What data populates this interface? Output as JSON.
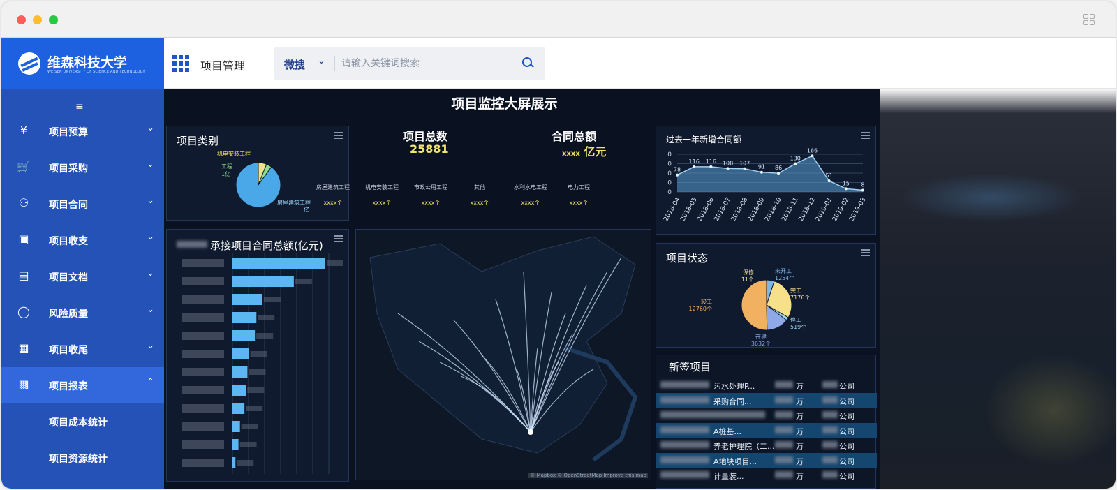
{
  "brand": {
    "name": "维森科技大学",
    "subtitle": "WEISEN UNIVERSITY OF SCIENCE AND TECHNOLOGY"
  },
  "sidebar": {
    "items": [
      {
        "label": "项目预算",
        "icon": "wallet-yen-icon"
      },
      {
        "label": "项目采购",
        "icon": "cart-icon"
      },
      {
        "label": "项目合同",
        "icon": "stamp-icon"
      },
      {
        "label": "项目收支",
        "icon": "purse-icon"
      },
      {
        "label": "项目文档",
        "icon": "inbox-icon"
      },
      {
        "label": "风险质量",
        "icon": "shield-check-icon"
      },
      {
        "label": "项目收尾",
        "icon": "archive-icon"
      },
      {
        "label": "项目报表",
        "icon": "chart-icon",
        "expanded": true
      }
    ],
    "subitems": [
      "项目成本统计",
      "项目资源统计"
    ]
  },
  "header": {
    "module": "项目管理",
    "search": {
      "scope": "微搜",
      "placeholder": "请输入关键词搜索"
    }
  },
  "dashboard": {
    "title": "项目监控大屏展示",
    "kpis": {
      "projects": {
        "label": "项目总数",
        "value": "25881"
      },
      "contracts": {
        "label": "合同总额",
        "value_prefix": "xxxx",
        "value_unit": "亿元"
      }
    },
    "categories": [
      {
        "name": "房屋建筑工程",
        "value": "xxxx个"
      },
      {
        "name": "机电安装工程",
        "value": "xxxx个"
      },
      {
        "name": "市政公用工程",
        "value": "xxxx个"
      },
      {
        "name": "其他",
        "value": "xxxx个"
      },
      {
        "name": "水利水电工程",
        "value": "xxxx个"
      },
      {
        "name": "电力工程",
        "value": "xxxx个"
      }
    ],
    "panels": {
      "category": "项目类别",
      "contract_total": "承接项目合同总额(亿元)",
      "monthly": "过去一年新增合同额",
      "status": "项目状态",
      "new_projects": "新签项目"
    },
    "map_attribution": "© Mapbox © OpenStreetMap Improve this map",
    "new_projects": [
      {
        "name": "污水处理P...",
        "amount": "万",
        "company": "公司"
      },
      {
        "name": "采购合同...",
        "amount": "万",
        "company": "公司"
      },
      {
        "name": "",
        "amount": "万",
        "company": "公司"
      },
      {
        "name": "A桩基...",
        "amount": "万",
        "company": "公司"
      },
      {
        "name": "养老护理院（二...",
        "amount": "万",
        "company": "公司"
      },
      {
        "name": "A地块项目...",
        "amount": "万",
        "company": "公司"
      },
      {
        "name": "计量装...",
        "amount": "万",
        "company": "公司"
      }
    ]
  },
  "chart_data": [
    {
      "type": "pie",
      "title": "项目类别",
      "labels": [
        "机电安装工程",
        "工程",
        "房屋建筑工程"
      ],
      "label_values": [
        "",
        "1亿",
        "亿"
      ],
      "values": [
        6,
        4,
        90
      ],
      "colors": [
        "#f2e38a",
        "#8fe08a",
        "#4aa8e8"
      ]
    },
    {
      "type": "bar",
      "title": "承接项目合同总额(亿元)",
      "orientation": "horizontal",
      "values": [
        62,
        41,
        20,
        16,
        15,
        11,
        10,
        9,
        8,
        5,
        4,
        2
      ],
      "xlim": [
        0,
        70
      ],
      "color": "#5cb6f2"
    },
    {
      "type": "area",
      "title": "过去一年新增合同额",
      "categories": [
        "2018-04",
        "2018-05",
        "2018-06",
        "2018-07",
        "2018-08",
        "2018-09",
        "2018-10",
        "2018-11",
        "2018-12",
        "2019-01",
        "2019-02",
        "2019-03"
      ],
      "values": [
        78,
        116,
        116,
        108,
        107,
        91,
        86,
        130,
        166,
        51,
        15,
        8
      ],
      "y_tick_labels": [
        "0",
        "0",
        "0",
        "0",
        "0"
      ],
      "color": "#5a9fd6"
    },
    {
      "type": "pie",
      "title": "项目状态",
      "labels": [
        "保修",
        "未开工",
        "完工",
        "停工",
        "在建",
        "竣工"
      ],
      "values": [
        11,
        1254,
        7176,
        519,
        3632,
        12760
      ],
      "value_labels": [
        "11个",
        "1254个",
        "7176个",
        "519个",
        "3632个",
        "12760个"
      ],
      "colors": [
        "#f2e38a",
        "#7fb6e8",
        "#f7e08a",
        "#9fd8ef",
        "#8fa9e8",
        "#f2b160"
      ]
    }
  ]
}
